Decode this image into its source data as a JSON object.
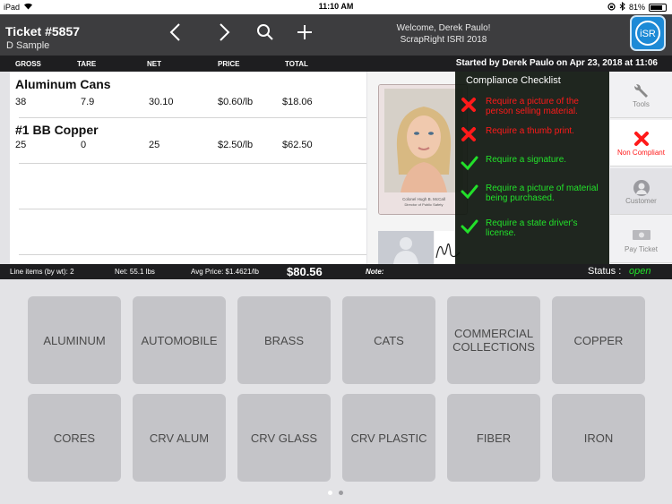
{
  "status_bar": {
    "device": "iPad",
    "time": "11:10 AM",
    "battery": "81%",
    "battery_level": 0.81
  },
  "header": {
    "ticket_title": "Ticket #5857",
    "ticket_subtitle": "D Sample",
    "welcome": "Welcome, Derek Paulo!",
    "org": "ScrapRight ISRI 2018",
    "logo_text": "iSR"
  },
  "columns": {
    "gross": "GROSS",
    "tare": "TARE",
    "net": "NET",
    "price": "PRICE",
    "total": "TOTAL"
  },
  "started_by": "Started by Derek Paulo on Apr 23, 2018 at 11:06",
  "line_items": [
    {
      "name": "Aluminum Cans",
      "gross": "38",
      "tare": "7.9",
      "net": "30.10",
      "price": "$0.60/lb",
      "total": "$18.06"
    },
    {
      "name": "#1 BB Copper",
      "gross": "25",
      "tare": "0",
      "net": "25",
      "price": "$2.50/lb",
      "total": "$62.50"
    }
  ],
  "license": {
    "caption_name": "Colonel Hugh B. McCall",
    "caption_title": "Director of Public Safety"
  },
  "compliance": {
    "title": "Compliance Checklist",
    "items": [
      {
        "text": "Require a picture of the person selling material.",
        "ok": false
      },
      {
        "text": "Require a thumb print.",
        "ok": false
      },
      {
        "text": "Require a signature.",
        "ok": true
      },
      {
        "text": "Require a picture of material being purchased.",
        "ok": true
      },
      {
        "text": "Require a state driver's license.",
        "ok": true
      }
    ]
  },
  "side_buttons": {
    "tools": "Tools",
    "non_compliant": "Non Compliant",
    "customer": "Customer",
    "pay_ticket": "Pay Ticket"
  },
  "summary": {
    "line_items": "Line items (by wt): 2",
    "net": "Net: 55.1 lbs",
    "avg_price": "Avg Price: $1.4621/lb",
    "total": "$80.56",
    "note_label": "Note:",
    "status_label": "Status :",
    "status_value": "open"
  },
  "categories": [
    "ALUMINUM",
    "AUTOMOBILE",
    "BRASS",
    "CATS",
    "COMMERCIAL COLLECTIONS",
    "COPPER",
    "CORES",
    "CRV ALUM",
    "CRV GLASS",
    "CRV PLASTIC",
    "FIBER",
    "IRON"
  ],
  "colors": {
    "header_bg": "#3d3d3f",
    "bar_bg": "#1e1e20",
    "logo_blue": "#1d8ad6",
    "red": "#ff1a1a",
    "green": "#22e02a",
    "tile": "#c4c4c8"
  },
  "icons": [
    "wifi-icon",
    "back-arrow-icon",
    "forward-arrow-icon",
    "search-icon",
    "add-icon",
    "wrench-icon",
    "x-icon",
    "person-icon",
    "cash-icon",
    "check-icon"
  ]
}
